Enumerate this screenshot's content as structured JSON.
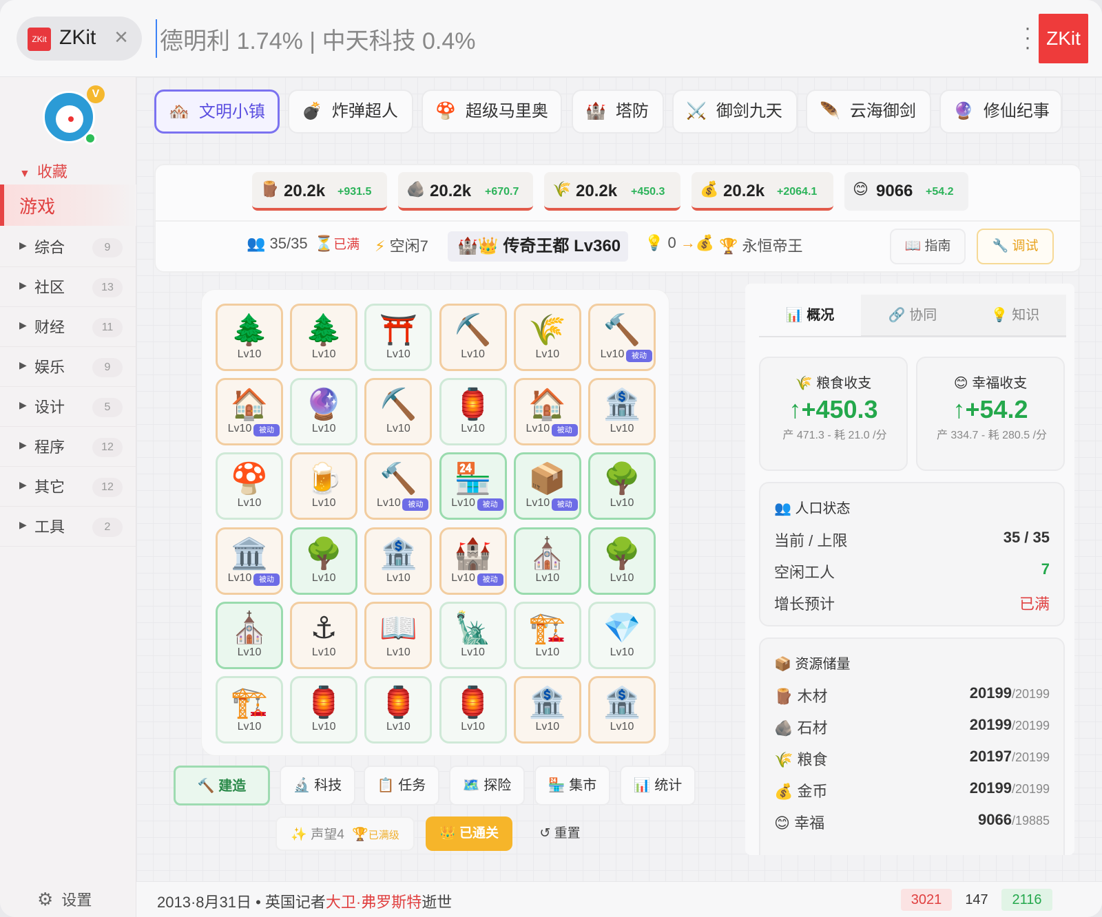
{
  "topbar": {
    "app_logo_text": "ZKit",
    "app_name": "ZKit",
    "ticker_value": "德明利 1.74% | 中天科技 0.4%",
    "brand_label": "ZKit"
  },
  "sidebar": {
    "vip_badge": "V",
    "favorites_label": "收藏",
    "active_item": "游戏",
    "items": [
      {
        "label": "综合",
        "count": "9"
      },
      {
        "label": "社区",
        "count": "13"
      },
      {
        "label": "财经",
        "count": "11"
      },
      {
        "label": "娱乐",
        "count": "9"
      },
      {
        "label": "设计",
        "count": "5"
      },
      {
        "label": "程序",
        "count": "12"
      },
      {
        "label": "其它",
        "count": "12"
      },
      {
        "label": "工具",
        "count": "2"
      }
    ],
    "settings_label": "设置"
  },
  "tabs": [
    {
      "icon": "🏘️",
      "label": "文明小镇"
    },
    {
      "icon": "💣",
      "label": "炸弹超人"
    },
    {
      "icon": "🍄",
      "label": "超级马里奥"
    },
    {
      "icon": "🏰",
      "label": "塔防"
    },
    {
      "icon": "⚔️",
      "label": "御剑九天"
    },
    {
      "icon": "🪶",
      "label": "云海御剑"
    },
    {
      "icon": "🔮",
      "label": "修仙纪事"
    }
  ],
  "resources": [
    {
      "icon": "🪵",
      "value": "20.2k",
      "delta": "+931.5"
    },
    {
      "icon": "🪨",
      "value": "20.2k",
      "delta": "+670.7"
    },
    {
      "icon": "🌾",
      "value": "20.2k",
      "delta": "+450.3"
    },
    {
      "icon": "💰",
      "value": "20.2k",
      "delta": "+2064.1"
    },
    {
      "icon": "😊",
      "value": "9066",
      "delta": "+54.2"
    }
  ],
  "stats": {
    "population": "35/35",
    "pop_status": "已满",
    "idle": "空闲7",
    "title_icon": "🏰👑",
    "title": "传奇王都 Lv360",
    "ideas": "0",
    "rank": "永恒帝王",
    "guide_label": "指南",
    "debug_label": "调试"
  },
  "grid": [
    [
      {
        "e": "🌲",
        "lv": "Lv10",
        "s": "orange"
      },
      {
        "e": "🌲",
        "lv": "Lv10",
        "s": "orange"
      },
      {
        "e": "⛩️",
        "lv": "Lv10",
        "s": "light"
      },
      {
        "e": "⛏️",
        "lv": "Lv10",
        "s": "orange"
      },
      {
        "e": "🌾",
        "lv": "Lv10",
        "s": "orange"
      },
      {
        "e": "🔨",
        "lv": "Lv10",
        "s": "orange",
        "p": "被动"
      }
    ],
    [
      {
        "e": "🏠",
        "lv": "Lv10",
        "s": "orange",
        "p": "被动"
      },
      {
        "e": "🔮",
        "lv": "Lv10",
        "s": "light"
      },
      {
        "e": "⛏️",
        "lv": "Lv10",
        "s": "orange"
      },
      {
        "e": "🏮",
        "lv": "Lv10",
        "s": "light"
      },
      {
        "e": "🏠",
        "lv": "Lv10",
        "s": "orange",
        "p": "被动"
      },
      {
        "e": "🏦",
        "lv": "Lv10",
        "s": "orange"
      }
    ],
    [
      {
        "e": "🍄",
        "lv": "Lv10",
        "s": "light"
      },
      {
        "e": "🍺",
        "lv": "Lv10",
        "s": "orange"
      },
      {
        "e": "🔨",
        "lv": "Lv10",
        "s": "orange",
        "p": "被动"
      },
      {
        "e": "🏪",
        "lv": "Lv10",
        "s": "green",
        "p": "被动"
      },
      {
        "e": "📦",
        "lv": "Lv10",
        "s": "green",
        "p": "被动"
      },
      {
        "e": "🌳",
        "lv": "Lv10",
        "s": "green"
      }
    ],
    [
      {
        "e": "🏛️",
        "lv": "Lv10",
        "s": "orange",
        "p": "被动"
      },
      {
        "e": "🌳",
        "lv": "Lv10",
        "s": "green"
      },
      {
        "e": "🏦",
        "lv": "Lv10",
        "s": "orange"
      },
      {
        "e": "🏰",
        "lv": "Lv10",
        "s": "orange",
        "p": "被动"
      },
      {
        "e": "⛪",
        "lv": "Lv10",
        "s": "green"
      },
      {
        "e": "🌳",
        "lv": "Lv10",
        "s": "green"
      }
    ],
    [
      {
        "e": "⛪",
        "lv": "Lv10",
        "s": "green"
      },
      {
        "e": "⚓",
        "lv": "Lv10",
        "s": "orange"
      },
      {
        "e": "📖",
        "lv": "Lv10",
        "s": "orange"
      },
      {
        "e": "🗽",
        "lv": "Lv10",
        "s": "light"
      },
      {
        "e": "🏗️",
        "lv": "Lv10",
        "s": "light"
      },
      {
        "e": "💎",
        "lv": "Lv10",
        "s": "light"
      }
    ],
    [
      {
        "e": "🏗️",
        "lv": "Lv10",
        "s": "light"
      },
      {
        "e": "🏮",
        "lv": "Lv10",
        "s": "light"
      },
      {
        "e": "🏮",
        "lv": "Lv10",
        "s": "light"
      },
      {
        "e": "🏮",
        "lv": "Lv10",
        "s": "light"
      },
      {
        "e": "🏦",
        "lv": "Lv10",
        "s": "orange"
      },
      {
        "e": "🏦",
        "lv": "Lv10",
        "s": "orange"
      }
    ]
  ],
  "actions": [
    {
      "icon": "🔨",
      "label": "建造"
    },
    {
      "icon": "🔬",
      "label": "科技"
    },
    {
      "icon": "📋",
      "label": "任务"
    },
    {
      "icon": "🗺️",
      "label": "探险"
    },
    {
      "icon": "🏪",
      "label": "集市"
    },
    {
      "icon": "📊",
      "label": "统计"
    }
  ],
  "sub_actions": {
    "prestige": "声望4",
    "prestige_status": "已满级",
    "cleared": "已通关",
    "reset": "重置"
  },
  "right_panel": {
    "tabs": [
      {
        "icon": "📊",
        "label": "概况"
      },
      {
        "icon": "🔗",
        "label": "协同"
      },
      {
        "icon": "💡",
        "label": "知识"
      }
    ],
    "food_income": {
      "title": "粮食收支",
      "value": "+450.3",
      "detail": "产 471.3 - 耗 21.0 /分"
    },
    "happy_income": {
      "title": "幸福收支",
      "value": "+54.2",
      "detail": "产 334.7 - 耗 280.5 /分"
    },
    "population": {
      "title": "人口状态",
      "rows": [
        {
          "label": "当前 / 上限",
          "value": "35 / 35"
        },
        {
          "label": "空闲工人",
          "value": "7"
        },
        {
          "label": "增长预计",
          "value": "已满"
        }
      ]
    },
    "storage": {
      "title": "资源储量",
      "rows": [
        {
          "icon": "🪵",
          "label": "木材",
          "value": "20199",
          "max": "/20199"
        },
        {
          "icon": "🪨",
          "label": "石材",
          "value": "20199",
          "max": "/20199"
        },
        {
          "icon": "🌾",
          "label": "粮食",
          "value": "20197",
          "max": "/20199"
        },
        {
          "icon": "💰",
          "label": "金币",
          "value": "20199",
          "max": "/20199"
        },
        {
          "icon": "😊",
          "label": "幸福",
          "value": "9066",
          "max": "/19885"
        }
      ]
    }
  },
  "footer": {
    "news_prefix": "2013·8月31日 • 英国记者",
    "news_highlight": "大卫·弗罗斯特",
    "news_suffix": "逝世",
    "counts": [
      "3021",
      "147",
      "2116"
    ]
  },
  "colors": {
    "accent": "#7b72f0",
    "danger": "#e04040",
    "success": "#24a84c",
    "gold": "#f5b022"
  }
}
